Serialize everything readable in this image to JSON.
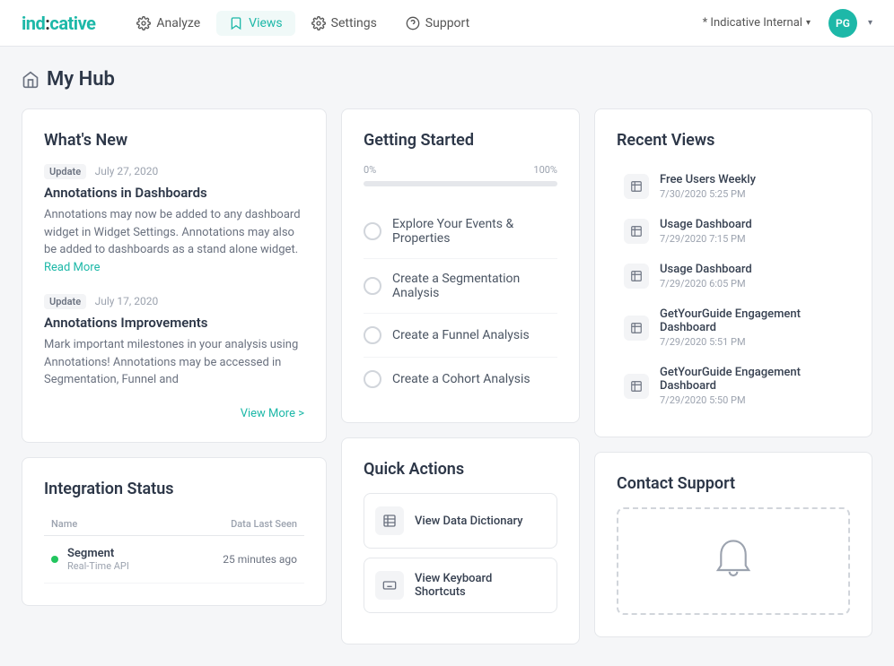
{
  "app": {
    "logo": "ind:cative",
    "logo_text": "indicative"
  },
  "nav": {
    "items": [
      {
        "id": "analyze",
        "label": "Analyze",
        "icon": "gear-icon"
      },
      {
        "id": "views",
        "label": "Views",
        "icon": "bookmark-icon",
        "active": true
      },
      {
        "id": "settings",
        "label": "Settings",
        "icon": "settings-icon"
      },
      {
        "id": "support",
        "label": "Support",
        "icon": "support-icon"
      }
    ],
    "workspace": "* Indicative Internal",
    "user_initials": "PG"
  },
  "page": {
    "title": "My Hub"
  },
  "whats_new": {
    "title": "What's New",
    "items": [
      {
        "badge": "Update",
        "date": "July 27, 2020",
        "title": "Annotations in Dashboards",
        "body": "Annotations may now be added to any dashboard widget in Widget Settings. Annotations may also be added to dashboards as a stand alone widget.",
        "read_more": "Read More"
      },
      {
        "badge": "Update",
        "date": "July 17, 2020",
        "title": "Annotations Improvements",
        "body": "Mark important milestones in your analysis using Annotations! Annotations may be accessed in Segmentation, Funnel and"
      }
    ],
    "view_more": "View More >"
  },
  "getting_started": {
    "title": "Getting Started",
    "progress_start": "0%",
    "progress_end": "100%",
    "progress_value": 0,
    "items": [
      {
        "label": "Explore Your Events & Properties",
        "done": false
      },
      {
        "label": "Create a Segmentation Analysis",
        "done": false
      },
      {
        "label": "Create a Funnel Analysis",
        "done": false
      },
      {
        "label": "Create a Cohort Analysis",
        "done": false
      }
    ]
  },
  "recent_views": {
    "title": "Recent Views",
    "items": [
      {
        "label": "Free Users Weekly",
        "date": "7/30/2020 5:25 PM"
      },
      {
        "label": "Usage Dashboard",
        "date": "7/29/2020 7:15 PM"
      },
      {
        "label": "Usage Dashboard",
        "date": "7/29/2020 6:05 PM"
      },
      {
        "label": "GetYourGuide Engagement Dashboard",
        "date": "7/29/2020 5:51 PM"
      },
      {
        "label": "GetYourGuide Engagement Dashboard",
        "date": "7/29/2020 5:50 PM"
      }
    ]
  },
  "integration_status": {
    "title": "Integration Status",
    "col_name": "Name",
    "col_data": "Data Last Seen",
    "items": [
      {
        "name": "Segment",
        "sub": "Real-Time API",
        "data_seen": "25 minutes ago",
        "status": "active"
      }
    ]
  },
  "quick_actions": {
    "title": "Quick Actions",
    "items": [
      {
        "id": "data-dictionary",
        "label": "View Data Dictionary",
        "icon": "table-icon"
      },
      {
        "id": "keyboard-shortcuts",
        "label": "View Keyboard Shortcuts",
        "icon": "keyboard-icon"
      }
    ]
  },
  "contact_support": {
    "title": "Contact Support"
  }
}
